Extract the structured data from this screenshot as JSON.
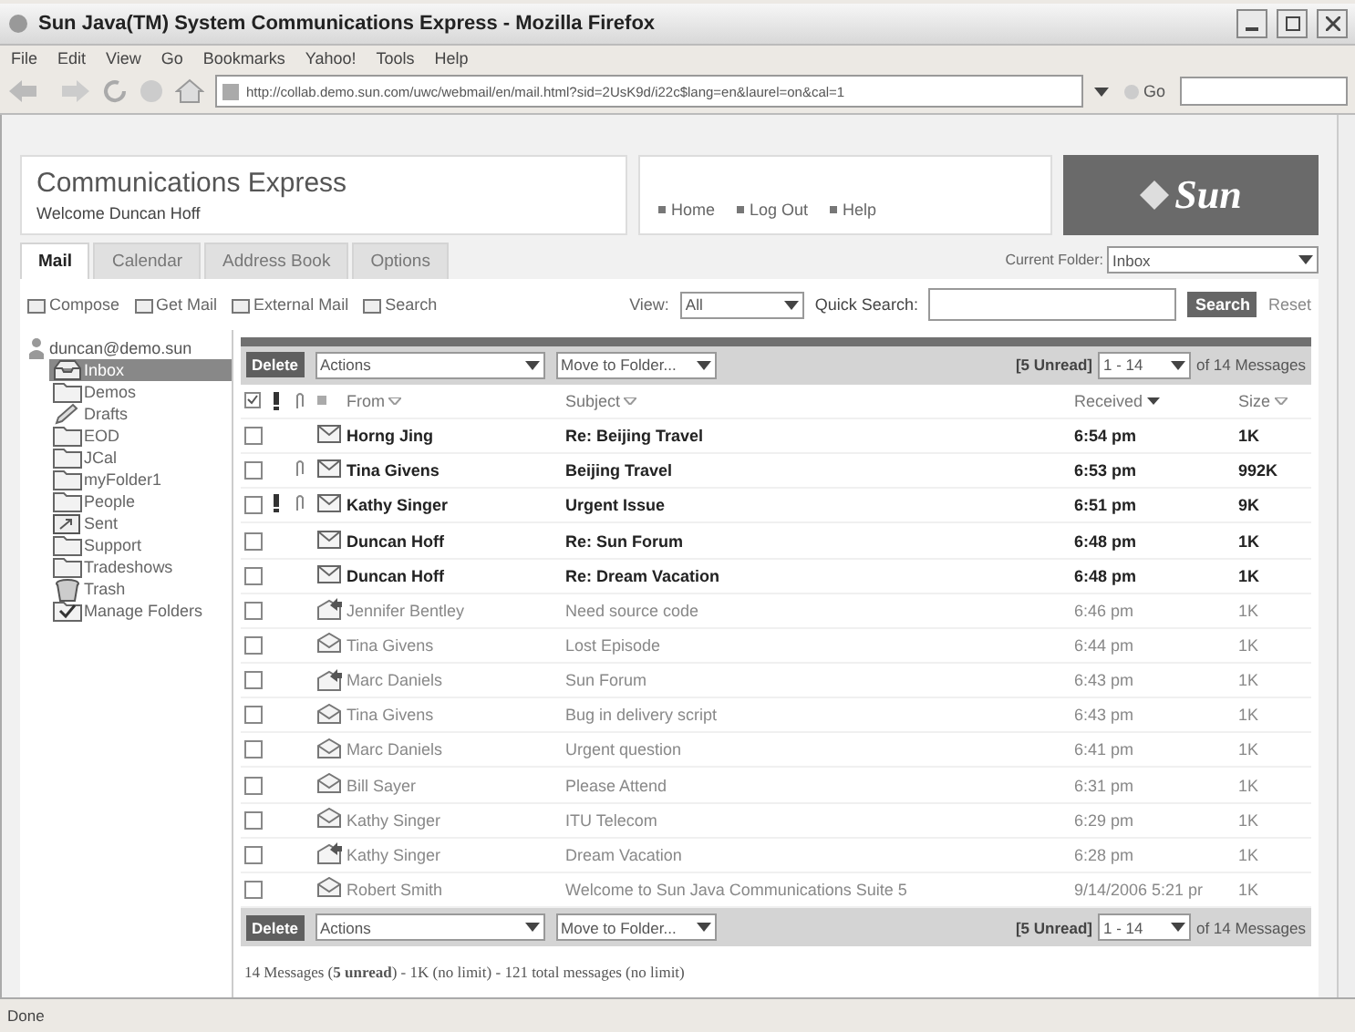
{
  "window": {
    "title": "Sun Java(TM) System Communications Express - Mozilla Firefox"
  },
  "menu": [
    "File",
    "Edit",
    "View",
    "Go",
    "Bookmarks",
    "Yahoo!",
    "Tools",
    "Help"
  ],
  "navbar": {
    "url": "http://collab.demo.sun.com/uwc/webmail/en/mail.html?sid=2UsK9d/i22c$lang=en&laurel=on&cal=1",
    "go": "Go"
  },
  "header": {
    "app_title": "Communications Express",
    "welcome": "Welcome Duncan Hoff",
    "links": [
      "Home",
      "Log Out",
      "Help"
    ],
    "logo": "Sun"
  },
  "tabs": [
    {
      "label": "Mail",
      "selected": true
    },
    {
      "label": "Calendar",
      "selected": false
    },
    {
      "label": "Address Book",
      "selected": false
    },
    {
      "label": "Options",
      "selected": false
    }
  ],
  "current_folder": {
    "label": "Current Folder:",
    "value": "Inbox"
  },
  "toolbar": {
    "actions": [
      "Compose",
      "Get Mail",
      "External Mail",
      "Search"
    ],
    "view_label": "View:",
    "view_value": "All",
    "quick_search_label": "Quick Search:",
    "search_button": "Search",
    "reset": "Reset"
  },
  "folders": {
    "label": "duncan@demo.sun",
    "children": [
      {
        "label": "Inbox",
        "kind": "inbox",
        "selected": true
      },
      {
        "label": "Demos",
        "kind": "folder",
        "selected": false
      },
      {
        "label": "Drafts",
        "kind": "drafts",
        "selected": false
      },
      {
        "label": "EOD",
        "kind": "folder",
        "selected": false
      },
      {
        "label": "JCal",
        "kind": "folder",
        "selected": false
      },
      {
        "label": "myFolder1",
        "kind": "folder",
        "selected": false
      },
      {
        "label": "People",
        "kind": "folder",
        "selected": false
      },
      {
        "label": "Sent",
        "kind": "sent",
        "selected": false
      },
      {
        "label": "Support",
        "kind": "folder",
        "selected": false
      },
      {
        "label": "Tradeshows",
        "kind": "folder",
        "selected": false
      },
      {
        "label": "Trash",
        "kind": "trash",
        "selected": false
      },
      {
        "label": "Manage Folders",
        "kind": "manage",
        "selected": false
      }
    ]
  },
  "list_toolbar": {
    "delete": "Delete",
    "actions": "Actions",
    "move": "Move to Folder...",
    "unread": "[5 Unread]",
    "range": "1 - 14",
    "of": "of 14 Messages"
  },
  "columns": [
    "From",
    "Subject",
    "Received",
    "Size"
  ],
  "messages": [
    {
      "from": "Horng Jing",
      "subject": "Re: Beijing Travel",
      "received": "6:54 pm",
      "size": "1K",
      "unread": true,
      "important": false,
      "attachment": false,
      "kind": "new",
      "checked": false
    },
    {
      "from": "Tina Givens",
      "subject": "Beijing Travel",
      "received": "6:53 pm",
      "size": "992K",
      "unread": true,
      "important": false,
      "attachment": true,
      "kind": "new",
      "checked": false
    },
    {
      "from": "Kathy Singer",
      "subject": "Urgent Issue",
      "received": "6:51 pm",
      "size": "9K",
      "unread": true,
      "important": true,
      "attachment": true,
      "kind": "new",
      "checked": false
    },
    {
      "from": "Duncan Hoff",
      "subject": "Re: Sun Forum",
      "received": "6:48 pm",
      "size": "1K",
      "unread": true,
      "important": false,
      "attachment": false,
      "kind": "new",
      "checked": false
    },
    {
      "from": "Duncan Hoff",
      "subject": "Re: Dream Vacation",
      "received": "6:48 pm",
      "size": "1K",
      "unread": true,
      "important": false,
      "attachment": false,
      "kind": "new",
      "checked": false
    },
    {
      "from": "Jennifer Bentley",
      "subject": "Need source code",
      "received": "6:46 pm",
      "size": "1K",
      "unread": false,
      "important": false,
      "attachment": false,
      "kind": "replied",
      "checked": false
    },
    {
      "from": "Tina Givens",
      "subject": "Lost Episode",
      "received": "6:44 pm",
      "size": "1K",
      "unread": false,
      "important": false,
      "attachment": false,
      "kind": "read",
      "checked": false
    },
    {
      "from": "Marc Daniels",
      "subject": "Sun Forum",
      "received": "6:43 pm",
      "size": "1K",
      "unread": false,
      "important": false,
      "attachment": false,
      "kind": "replied",
      "checked": false
    },
    {
      "from": "Tina Givens",
      "subject": "Bug in delivery script",
      "received": "6:43 pm",
      "size": "1K",
      "unread": false,
      "important": false,
      "attachment": false,
      "kind": "read",
      "checked": false
    },
    {
      "from": "Marc Daniels",
      "subject": "Urgent question",
      "received": "6:41 pm",
      "size": "1K",
      "unread": false,
      "important": false,
      "attachment": false,
      "kind": "read",
      "checked": false
    },
    {
      "from": "Bill Sayer",
      "subject": "Please Attend",
      "received": "6:31 pm",
      "size": "1K",
      "unread": false,
      "important": false,
      "attachment": false,
      "kind": "read",
      "checked": false
    },
    {
      "from": "Kathy Singer",
      "subject": "ITU Telecom",
      "received": "6:29 pm",
      "size": "1K",
      "unread": false,
      "important": false,
      "attachment": false,
      "kind": "read",
      "checked": false
    },
    {
      "from": "Kathy Singer",
      "subject": "Dream Vacation",
      "received": "6:28 pm",
      "size": "1K",
      "unread": false,
      "important": false,
      "attachment": false,
      "kind": "replied",
      "checked": false
    },
    {
      "from": "Robert Smith",
      "subject": "Welcome to Sun Java Communications Suite 5",
      "received": "9/14/2006 5:21 pr",
      "size": "1K",
      "unread": false,
      "important": false,
      "attachment": false,
      "kind": "read",
      "checked": false
    }
  ],
  "bottom_toolbar": {
    "delete": "Delete",
    "actions": "Actions",
    "move": "Move to Folder...",
    "unread": "[5 Unread]",
    "range": "1 - 14",
    "of": "of 14 Messages"
  },
  "summary": "14 Messages (**5 unread**) - 1K (no limit) - 121 total messages (no limit)",
  "status_bar": "Done"
}
